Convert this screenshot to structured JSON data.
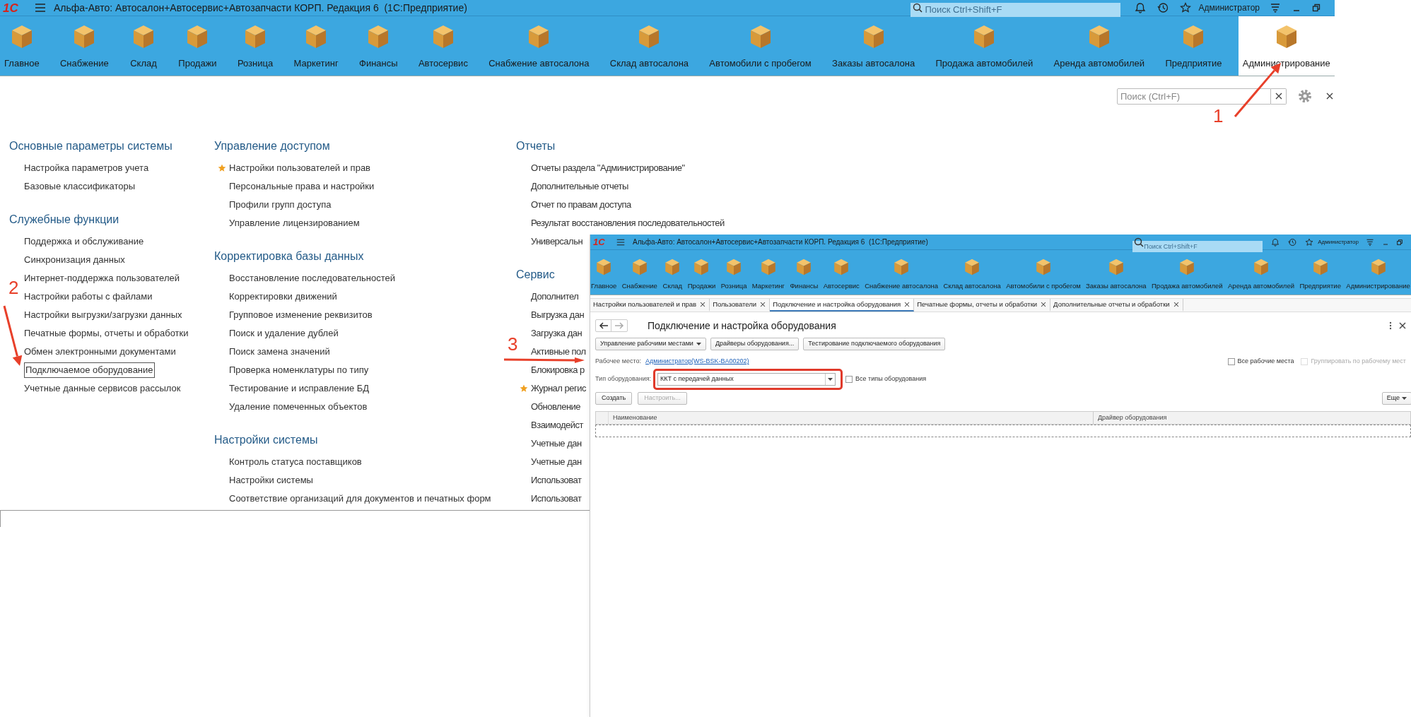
{
  "window": {
    "logo": "1С",
    "title": "Альфа-Авто: Автосалон+Автосервис+Автозапчасти КОРП. Редакция 6  (1С:Предприятие)",
    "search": {
      "placeholder": "Поиск Ctrl+Shift+F"
    },
    "user": "Администратор"
  },
  "sections": [
    {
      "label": "Главное",
      "selected": false
    },
    {
      "label": "Снабжение",
      "selected": false
    },
    {
      "label": "Склад",
      "selected": false
    },
    {
      "label": "Продажи",
      "selected": false
    },
    {
      "label": "Розница",
      "selected": false
    },
    {
      "label": "Маркетинг",
      "selected": false
    },
    {
      "label": "Финансы",
      "selected": false
    },
    {
      "label": "Автосервис",
      "selected": false
    },
    {
      "label": "Снабжение автосалона",
      "selected": false
    },
    {
      "label": "Склад автосалона",
      "selected": false
    },
    {
      "label": "Автомобили с пробегом",
      "selected": false
    },
    {
      "label": "Заказы автосалона",
      "selected": false
    },
    {
      "label": "Продажа автомобилей",
      "selected": false
    },
    {
      "label": "Аренда автомобилей",
      "selected": false
    },
    {
      "label": "Предприятие",
      "selected": false
    },
    {
      "label": "Администрирование",
      "selected": true
    }
  ],
  "page_search": {
    "placeholder": "Поиск (Ctrl+F)"
  },
  "columns": [
    {
      "groups": [
        {
          "title": "Основные параметры системы",
          "items": [
            {
              "label": "Настройка параметров учета",
              "favorite": false,
              "selected": false
            },
            {
              "label": "Базовые классификаторы",
              "favorite": false,
              "selected": false
            }
          ]
        },
        {
          "title": "Служебные функции",
          "items": [
            {
              "label": "Поддержка и обслуживание",
              "favorite": false,
              "selected": false
            },
            {
              "label": "Синхронизация данных",
              "favorite": false,
              "selected": false
            },
            {
              "label": "Интернет-поддержка пользователей",
              "favorite": false,
              "selected": false
            },
            {
              "label": "Настройки работы с файлами",
              "favorite": false,
              "selected": false
            },
            {
              "label": "Настройки выгрузки/загрузки данных",
              "favorite": false,
              "selected": false
            },
            {
              "label": "Печатные формы, отчеты и обработки",
              "favorite": false,
              "selected": false
            },
            {
              "label": "Обмен электронными документами",
              "favorite": false,
              "selected": false
            },
            {
              "label": "Подключаемое оборудование",
              "favorite": false,
              "selected": true
            },
            {
              "label": "Учетные данные сервисов рассылок",
              "favorite": false,
              "selected": false
            }
          ]
        }
      ]
    },
    {
      "groups": [
        {
          "title": "Управление доступом",
          "items": [
            {
              "label": "Настройки пользователей и прав",
              "favorite": true,
              "selected": false
            },
            {
              "label": "Персональные права и настройки",
              "favorite": false,
              "selected": false
            },
            {
              "label": "Профили групп доступа",
              "favorite": false,
              "selected": false
            },
            {
              "label": "Управление лицензированием",
              "favorite": false,
              "selected": false
            }
          ]
        },
        {
          "title": "Корректировка базы данных",
          "items": [
            {
              "label": "Восстановление последовательностей",
              "favorite": false,
              "selected": false
            },
            {
              "label": "Корректировки движений",
              "favorite": false,
              "selected": false
            },
            {
              "label": "Групповое изменение реквизитов",
              "favorite": false,
              "selected": false
            },
            {
              "label": "Поиск и удаление дублей",
              "favorite": false,
              "selected": false
            },
            {
              "label": "Поиск замена значений",
              "favorite": false,
              "selected": false
            },
            {
              "label": "Проверка номенклатуры по типу",
              "favorite": false,
              "selected": false
            },
            {
              "label": "Тестирование и исправление БД",
              "favorite": false,
              "selected": false
            },
            {
              "label": "Удаление помеченных объектов",
              "favorite": false,
              "selected": false
            }
          ]
        },
        {
          "title": "Настройки системы",
          "items": [
            {
              "label": "Контроль статуса поставщиков",
              "favorite": false,
              "selected": false
            },
            {
              "label": "Настройки системы",
              "favorite": false,
              "selected": false
            },
            {
              "label": "Соответствие организаций для документов и печатных форм",
              "favorite": false,
              "selected": false
            }
          ]
        }
      ]
    },
    {
      "groups": [
        {
          "title": "Отчеты",
          "items": [
            {
              "label": "Отчеты раздела \"Администрирование\"",
              "favorite": false,
              "selected": false
            },
            {
              "label": "Дополнительные отчеты",
              "favorite": false,
              "selected": false
            },
            {
              "label": "Отчет по правам доступа",
              "favorite": false,
              "selected": false
            },
            {
              "label": "Результат восстановления последовательностей",
              "favorite": false,
              "selected": false
            },
            {
              "label": "Универсальн",
              "favorite": false,
              "selected": false
            }
          ]
        },
        {
          "title": "Сервис",
          "items": [
            {
              "label": "Дополнител",
              "favorite": false,
              "selected": false
            },
            {
              "label": "Выгрузка дан",
              "favorite": false,
              "selected": false
            },
            {
              "label": "Загрузка дан",
              "favorite": false,
              "selected": false
            },
            {
              "label": "Активные пол",
              "favorite": false,
              "selected": false
            },
            {
              "label": "Блокировка р",
              "favorite": false,
              "selected": false
            },
            {
              "label": "Журнал регис",
              "favorite": true,
              "selected": false
            },
            {
              "label": "Обновление",
              "favorite": false,
              "selected": false
            },
            {
              "label": "Взаимодейст",
              "favorite": false,
              "selected": false
            },
            {
              "label": "Учетные дан",
              "favorite": false,
              "selected": false
            },
            {
              "label": "Учетные дан",
              "favorite": false,
              "selected": false
            },
            {
              "label": "Использоват",
              "favorite": false,
              "selected": false
            },
            {
              "label": "Использоват",
              "favorite": false,
              "selected": false
            }
          ]
        }
      ]
    }
  ],
  "annotations": [
    {
      "label": "1"
    },
    {
      "label": "2"
    },
    {
      "label": "3"
    }
  ],
  "inset": {
    "window": {
      "logo": "1С",
      "title": "Альфа-Авто: Автосалон+Автосервис+Автозапчасти КОРП. Редакция 6  (1С:Предприятие)",
      "search": {
        "placeholder": "Поиск Ctrl+Shift+F"
      },
      "user": "Администратор"
    },
    "sections": [
      {
        "label": "Главное",
        "selected": false
      },
      {
        "label": "Снабжение",
        "selected": false
      },
      {
        "label": "Склад",
        "selected": false
      },
      {
        "label": "Продажи",
        "selected": false
      },
      {
        "label": "Розница",
        "selected": false
      },
      {
        "label": "Маркетинг",
        "selected": false
      },
      {
        "label": "Финансы",
        "selected": false
      },
      {
        "label": "Автосервис",
        "selected": false
      },
      {
        "label": "Снабжение автосалона",
        "selected": false
      },
      {
        "label": "Склад автосалона",
        "selected": false
      },
      {
        "label": "Автомобили с пробегом",
        "selected": false
      },
      {
        "label": "Заказы автосалона",
        "selected": false
      },
      {
        "label": "Продажа автомобилей",
        "selected": false
      },
      {
        "label": "Аренда автомобилей",
        "selected": false
      },
      {
        "label": "Предприятие",
        "selected": false
      },
      {
        "label": "Администрирование",
        "selected": false
      }
    ],
    "tabs": [
      {
        "label": "Настройки пользователей и прав",
        "selected": false
      },
      {
        "label": "Пользователи",
        "selected": false
      },
      {
        "label": "Подключение и настройка оборудования",
        "selected": true
      },
      {
        "label": "Печатные формы, отчеты и обработки",
        "selected": false
      },
      {
        "label": "Дополнительные отчеты и обработки",
        "selected": false
      }
    ],
    "heading": "Подключение и настройка оборудования",
    "buttons": [
      {
        "label": "Управление рабочими местами",
        "dropdown": true
      },
      {
        "label": "Драйверы оборудования...",
        "dropdown": false
      },
      {
        "label": "Тестирование подключаемого оборудования",
        "dropdown": false
      }
    ],
    "workplace": {
      "label": "Рабочее место:",
      "link": "Администратор(WS-BSK-BA00202)"
    },
    "options": [
      {
        "label": "Все рабочие места",
        "checked": false,
        "disabled": false
      },
      {
        "label": "Группировать по рабочему мест",
        "checked": false,
        "disabled": true
      }
    ],
    "equipment_type": {
      "label": "Тип оборудования:",
      "value": "ККТ с передачей данных",
      "highlighted": true
    },
    "all_types": {
      "label": "Все типы оборудования",
      "checked": false
    },
    "actions": [
      {
        "label": "Создать",
        "disabled": false
      },
      {
        "label": "Настроить...",
        "disabled": true
      }
    ],
    "more": {
      "label": "Еще"
    },
    "table": {
      "columns": [
        "Наименование",
        "Драйвер оборудования"
      ]
    }
  }
}
